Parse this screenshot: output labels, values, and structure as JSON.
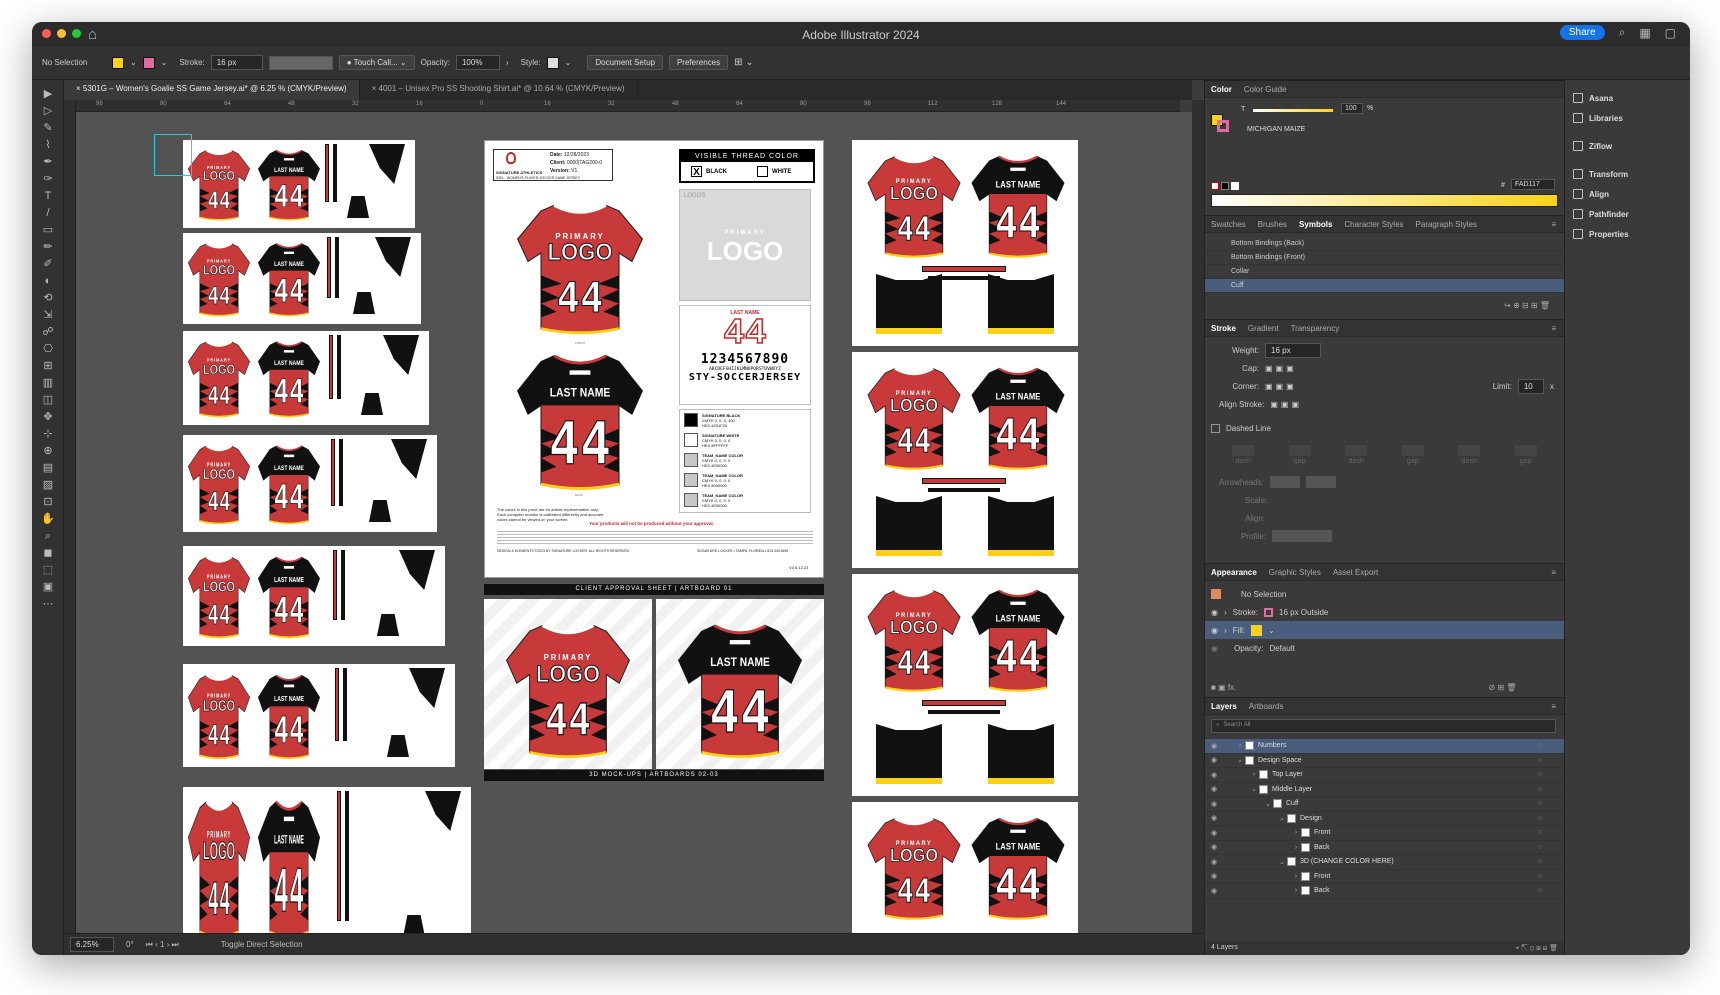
{
  "window": {
    "title": "Adobe Illustrator 2024",
    "share_label": "Share"
  },
  "control": {
    "selection": "No Selection",
    "stroke_label": "Stroke:",
    "stroke_value": "16 px",
    "brush": "Touch Call...",
    "opacity_label": "Opacity:",
    "opacity_value": "100%",
    "style_label": "Style:",
    "doc_setup": "Document Setup",
    "preferences": "Preferences"
  },
  "tabs": [
    {
      "label": "5301G – Women's Goalie SS Game Jersey.ai* @ 6.25 % (CMYK/Preview)"
    },
    {
      "label": "4001 – Unisex Pro SS Shooting Shirt.ai* @ 10.64 % (CMYK/Preview)"
    }
  ],
  "ruler": [
    "96",
    "80",
    "64",
    "48",
    "32",
    "16",
    "0",
    "16",
    "32",
    "48",
    "64",
    "80",
    "96",
    "112",
    "128",
    "144"
  ],
  "jersey": {
    "primary": "PRIMARY",
    "logo": "LOGO",
    "number": "44",
    "last_name": "LAST NAME"
  },
  "sheet": {
    "date_label": "Date:",
    "date": "12/28/2023",
    "client_label": "Client:",
    "client": "0000|TAG200-0",
    "version_label": "Version:",
    "version": "V1",
    "brand": "SIGNATURE ATHLETICS",
    "product": "5301 - WOMEN'S PLAYER SOCCER GAME JERSEY",
    "thread_title": "VISIBLE THREAD COLOR",
    "thread_black": "BLACK",
    "thread_white": "WHITE",
    "thread_x": "X",
    "logos_label": "LOGOS",
    "font_digits": "1234567890",
    "font_alpha": "ABCDEFGHIJKLMNOPQRSTUVWXYZ",
    "font_name": "STY-SOCCERJERSEY",
    "colors": [
      {
        "name": "SIGNATURE BLACK",
        "cmyk": "CMYK 0, 0, 0, 100",
        "hex": "HEX #231F20",
        "swatch": "#000000"
      },
      {
        "name": "SIGNATURE WHITE",
        "cmyk": "CMYK 0, 0, 0, 0",
        "hex": "HEX #FFFFFF",
        "swatch": "#ffffff"
      },
      {
        "name": "TEAM_NAME COLOR",
        "cmyk": "CMYK 0, 0, 0, 0",
        "hex": "HEX #000000",
        "swatch": "#c8c8c8"
      },
      {
        "name": "TEAM_NAME COLOR",
        "cmyk": "CMYK 0, 0, 0, 0",
        "hex": "HEX #000000",
        "swatch": "#c8c8c8"
      },
      {
        "name": "TEAM_NAME COLOR",
        "cmyk": "CMYK 0, 0, 0, 0",
        "hex": "HEX #000000",
        "swatch": "#c8c8c8"
      }
    ],
    "warning": "Your products will not be produced without your approval.",
    "front_label": "FRONT",
    "back_label": "BACK",
    "disclaimer": "The colors in this proof are for artistic representation only. Each computer monitor is calibrated differently and accurate colors cannot be viewed on your screen.",
    "footer_left": "DESIGN & ELEMENTS ©2023 BY SIGNATURE LOCKER. ALL RIGHTS RESERVED.",
    "footer_right": "SIGNATURE LOCKER • TAMPA, FLORIDA • 813.344.6691",
    "version_code": "V3 6.12.23",
    "approval_banner": "CLIENT APPROVAL SHEET | ARTBOARD 01",
    "mockup_banner": "3D MOCK-UPS | ARTBOARDS 02-03"
  },
  "color_panel": {
    "tab1": "Color",
    "tab2": "Color Guide",
    "tint_label": "T",
    "tint_value": "100",
    "pct": "%",
    "color_name": "MICHIGAN MAIZE",
    "hex_label": "#",
    "hex": "FAD117",
    "fill_color": "#FAD117",
    "stroke_color": "#E06C9F"
  },
  "symbols": {
    "tabs": [
      "Swatches",
      "Brushes",
      "Symbols",
      "Character Styles",
      "Paragraph Styles"
    ],
    "items": [
      "Bottom Bindings (Back)",
      "Bottom Bindings (Front)",
      "Collar",
      "Cuff"
    ],
    "selected": 3
  },
  "stroke_panel": {
    "tabs": [
      "Stroke",
      "Gradient",
      "Transparency"
    ],
    "weight_label": "Weight:",
    "weight": "16 px",
    "cap_label": "Cap:",
    "corner_label": "Corner:",
    "limit_label": "Limit:",
    "limit": "10",
    "limit_x": "x",
    "align_label": "Align Stroke:",
    "dashed_label": "Dashed Line",
    "dash_labels": [
      "dash",
      "gap",
      "dash",
      "gap",
      "dash",
      "gap"
    ],
    "arrowheads_label": "Arrowheads:",
    "scale_label": "Scale:",
    "align2_label": "Align:",
    "profile_label": "Profile:"
  },
  "appearance": {
    "tabs": [
      "Appearance",
      "Graphic Styles",
      "Asset Export"
    ],
    "no_selection": "No Selection",
    "stroke_label": "Stroke:",
    "stroke_value": "16 px  Outside",
    "fill_label": "Fill:",
    "opacity_label": "Opacity:",
    "opacity_value": "Default"
  },
  "layers": {
    "tabs": [
      "Layers",
      "Artboards"
    ],
    "search_placeholder": "Search All",
    "count": "4 Layers",
    "items": [
      {
        "name": "Numbers",
        "depth": 0,
        "arrow": "›",
        "sel": true
      },
      {
        "name": "Design Space",
        "depth": 0,
        "arrow": "⌄",
        "sel": false
      },
      {
        "name": "Top Layer",
        "depth": 1,
        "arrow": "›",
        "sel": false
      },
      {
        "name": "Middle Layer",
        "depth": 1,
        "arrow": "⌄",
        "sel": false
      },
      {
        "name": "Cuff",
        "depth": 2,
        "arrow": "⌄",
        "sel": false
      },
      {
        "name": "Design",
        "depth": 3,
        "arrow": "⌄",
        "sel": false
      },
      {
        "name": "Front",
        "depth": 4,
        "arrow": "›",
        "sel": false
      },
      {
        "name": "Back",
        "depth": 4,
        "arrow": "›",
        "sel": false
      },
      {
        "name": "3D (CHANGE COLOR HERE)",
        "depth": 3,
        "arrow": "⌄",
        "sel": false
      },
      {
        "name": "Front",
        "depth": 4,
        "arrow": "›",
        "sel": false
      },
      {
        "name": "Back",
        "depth": 4,
        "arrow": "›",
        "sel": false
      }
    ]
  },
  "sidebar": [
    "Asana",
    "Libraries",
    "Ziflow",
    "Transform",
    "Align",
    "Pathfinder",
    "Properties"
  ],
  "status": {
    "zoom": "6.25%",
    "rotation": "0°",
    "page": "1",
    "mode": "Toggle Direct Selection"
  }
}
